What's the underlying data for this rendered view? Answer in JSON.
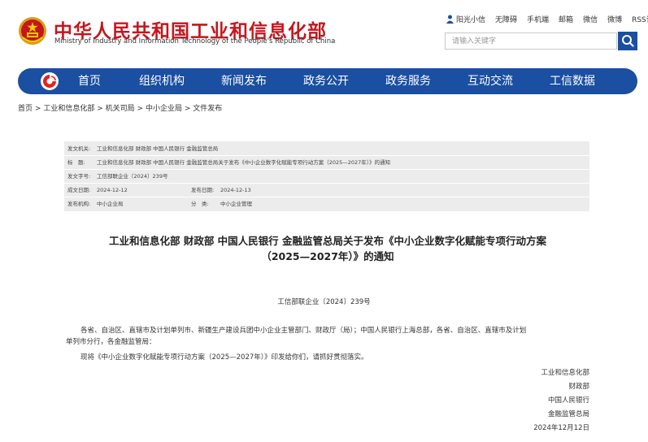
{
  "header": {
    "title_cn": "中华人民共和国工业和信息化部",
    "title_en": "Ministry of Industry and Information Technology of the People's Republic of China",
    "top_links": [
      "阳光小信",
      "无障碍",
      "手机端",
      "邮箱",
      "微信",
      "微博",
      "RSS订阅"
    ],
    "search_placeholder": "请输入关键字"
  },
  "nav": {
    "items": [
      "首页",
      "组织机构",
      "新闻发布",
      "政务公开",
      "政务服务",
      "互动交流",
      "工信数据"
    ]
  },
  "breadcrumb": [
    "首页",
    "工业和信息化部",
    "机关司局",
    "中小企业局",
    "文件发布"
  ],
  "breadcrumb_separator": ">",
  "meta": {
    "issuer_label": "发文机关:",
    "issuer": "工业和信息化部 财政部 中国人民银行 金融监管总局",
    "title_label": "标　题:",
    "title": "工业和信息化部 财政部 中国人民银行 金融监管总局关于发布《中小企业数字化赋能专项行动方案（2025—2027年）》的通知",
    "docno_label": "发文字号:",
    "docno": "工信部联企业〔2024〕239号",
    "date_label": "成文日期:",
    "date": "2024-12-12",
    "pubdate_label": "发布日期:",
    "pubdate": "2024-12-13",
    "agency_label": "发布机构:",
    "agency": "中小企业局",
    "category_label": "分　类:",
    "category": "中小企业管理"
  },
  "article": {
    "title_line1": "工业和信息化部 财政部 中国人民银行 金融监管总局关于发布《中小企业数字化赋能专项行动方案",
    "title_line2": "（2025—2027年）》的通知",
    "doc_number": "工信部联企业〔2024〕239号",
    "para1_line1": "各省、自治区、直辖市及计划单列市、新疆生产建设兵团中小企业主管部门、财政厅（局）；中国人民银行上海总部，各省、自治区、直辖市及计划",
    "para1_line2": "单列市分行，各金融监管局：",
    "para2": "现将《中小企业数字化赋能专项行动方案（2025—2027年）》印发给你们，请抓好贯彻落实。",
    "signatures": [
      "工业和信息化部",
      "财政部",
      "中国人民银行",
      "金融监管总局",
      "2024年12月12日"
    ]
  },
  "colors": {
    "brand_red": "#c6161d",
    "nav_blue": "#1a4fa1",
    "meta_bg": "#ececec"
  }
}
